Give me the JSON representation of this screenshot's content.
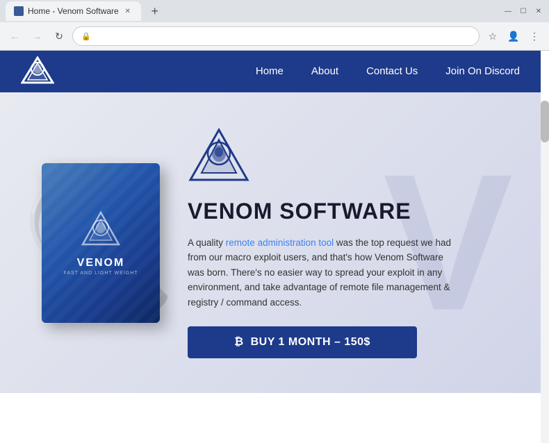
{
  "browser": {
    "tab_title": "Home - Venom Software",
    "tab_favicon": "W",
    "url": "",
    "nav": {
      "back_disabled": true,
      "forward_disabled": true
    }
  },
  "site": {
    "nav": {
      "links": [
        {
          "label": "Home",
          "key": "home"
        },
        {
          "label": "About",
          "key": "about"
        },
        {
          "label": "Contact Us",
          "key": "contact"
        },
        {
          "label": "Join On Discord",
          "key": "discord"
        }
      ]
    },
    "hero": {
      "title": "VENOM SOFTWARE",
      "description_part1": "A quality ",
      "description_link": "remote administration tool",
      "description_part2": " was the top request we had from our macro exploit users, and that's how Venom Software was born. There's no easier way to spread your exploit in any environment, and take advantage of remote file management & registry / command access.",
      "buy_btn_label": "BUY 1 MONTH – 150$",
      "box_title": "VENOM",
      "box_subtitle": "FAST AND LIGHT WEIGHT"
    }
  }
}
